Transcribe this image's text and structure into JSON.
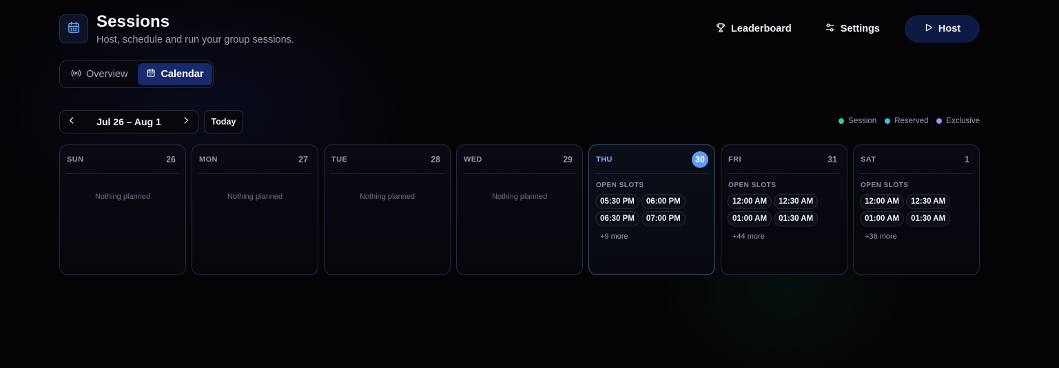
{
  "header": {
    "title": "Sessions",
    "subtitle": "Host, schedule and run your group sessions.",
    "actions": {
      "leaderboard": "Leaderboard",
      "settings": "Settings",
      "host": "Host"
    }
  },
  "tabs": [
    {
      "label": "Overview",
      "icon": "broadcast-icon",
      "active": false
    },
    {
      "label": "Calendar",
      "icon": "calendar-icon",
      "active": true
    }
  ],
  "week": {
    "range": "Jul 26 – Aug 1",
    "today_label": "Today"
  },
  "legend": [
    {
      "label": "Session",
      "color": "#34d399"
    },
    {
      "label": "Reserved",
      "color": "#38bdf8"
    },
    {
      "label": "Exclusive",
      "color": "#a78bfa"
    }
  ],
  "colors": {
    "accent": "#5b9df0",
    "host_button": "#0f1a44",
    "active_tab": "#172a6b"
  },
  "days": [
    {
      "name": "SUN",
      "num": "26",
      "empty_text": "Nothing planned"
    },
    {
      "name": "MON",
      "num": "27",
      "empty_text": "Nothing planned"
    },
    {
      "name": "TUE",
      "num": "28",
      "empty_text": "Nothing planned"
    },
    {
      "name": "WED",
      "num": "29",
      "empty_text": "Nothing planned"
    },
    {
      "name": "THU",
      "num": "30",
      "slots_label": "OPEN SLOTS",
      "slots": [
        "05:30 PM",
        "06:00 PM",
        "06:30 PM",
        "07:00 PM"
      ],
      "more": "+9 more"
    },
    {
      "name": "FRI",
      "num": "31",
      "slots_label": "OPEN SLOTS",
      "slots": [
        "12:00 AM",
        "12:30 AM",
        "01:00 AM",
        "01:30 AM"
      ],
      "more": "+44 more"
    },
    {
      "name": "SAT",
      "num": "1",
      "slots_label": "OPEN SLOTS",
      "slots": [
        "12:00 AM",
        "12:30 AM",
        "01:00 AM",
        "01:30 AM"
      ],
      "more": "+36 more"
    }
  ]
}
